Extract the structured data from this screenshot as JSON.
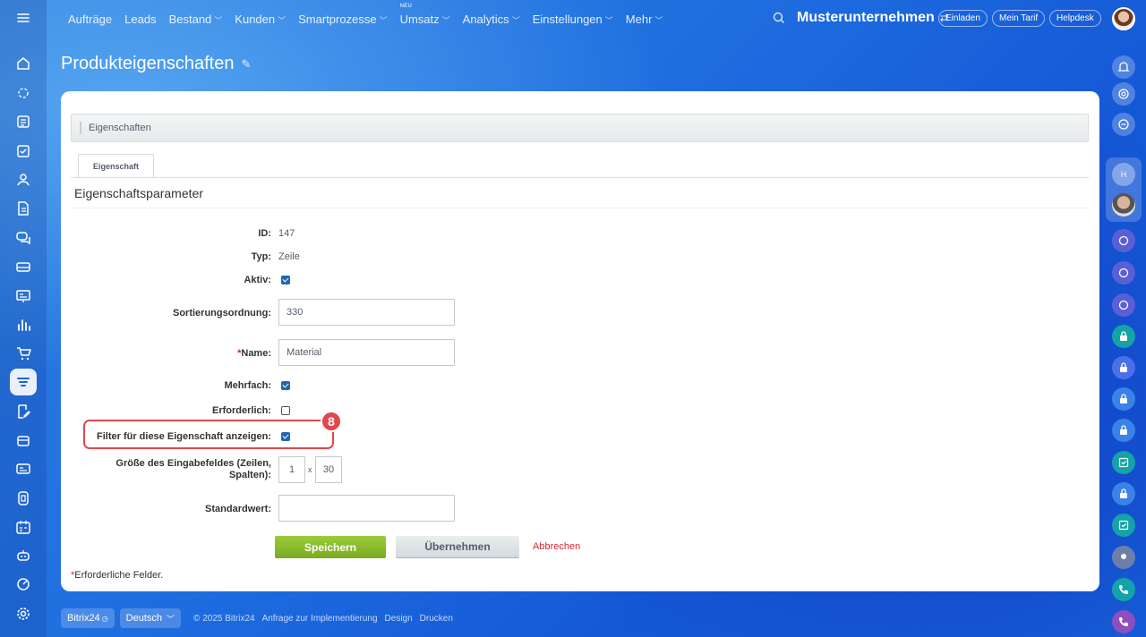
{
  "nav": {
    "items": [
      {
        "label": "Aufträge",
        "dropdown": false,
        "new": ""
      },
      {
        "label": "Leads",
        "dropdown": false,
        "new": ""
      },
      {
        "label": "Bestand",
        "dropdown": true,
        "new": ""
      },
      {
        "label": "Kunden",
        "dropdown": true,
        "new": ""
      },
      {
        "label": "Smartprozesse",
        "dropdown": true,
        "new": ""
      },
      {
        "label": "Umsatz",
        "dropdown": true,
        "new": "NEU"
      },
      {
        "label": "Analytics",
        "dropdown": true,
        "new": ""
      },
      {
        "label": "Einstellungen",
        "dropdown": true,
        "new": ""
      },
      {
        "label": "Mehr",
        "dropdown": true,
        "new": ""
      }
    ],
    "company": "Musterunternehmen",
    "invite": "Einladen",
    "plan": "Mein Tarif",
    "helpdesk": "Helpdesk"
  },
  "page": {
    "title": "Produkteigenschaften"
  },
  "breadcrumb": "Eigenschaften",
  "tab": "Eigenschaft",
  "section": "Eigenschaftsparameter",
  "form": {
    "id_label": "ID:",
    "id_value": "147",
    "type_label": "Typ:",
    "type_value": "Zeile",
    "active_label": "Aktiv:",
    "active_checked": true,
    "sort_label": "Sortierungsordnung:",
    "sort_value": "330",
    "name_req": "*",
    "name_label": "Name:",
    "name_value": "Material",
    "multiple_label": "Mehrfach:",
    "multiple_checked": true,
    "required_label": "Erforderlich:",
    "required_checked": false,
    "filter_label": "Filter für diese Eigenschaft anzeigen:",
    "filter_checked": true,
    "size_label_1": "Größe des Eingabefeldes (Zeilen,",
    "size_label_2": "Spalten):",
    "size_rows": "1",
    "size_x": "x",
    "size_cols": "30",
    "default_label": "Standardwert:",
    "default_value": ""
  },
  "annotation": {
    "badge": "8"
  },
  "buttons": {
    "save": "Speichern",
    "apply": "Übernehmen",
    "cancel": "Abbrechen"
  },
  "required_note": {
    "star": "*",
    "text": "Erforderliche Felder."
  },
  "footer": {
    "brand": "Bitrix24",
    "language": "Deutsch",
    "copyright": "© 2025 Bitrix24",
    "links": [
      "Anfrage zur Implementierung",
      "Design",
      "Drucken"
    ]
  },
  "colors": {
    "accent": "#2067b0",
    "save_green": "#8bbd2f",
    "highlight_red": "#e0484e"
  }
}
